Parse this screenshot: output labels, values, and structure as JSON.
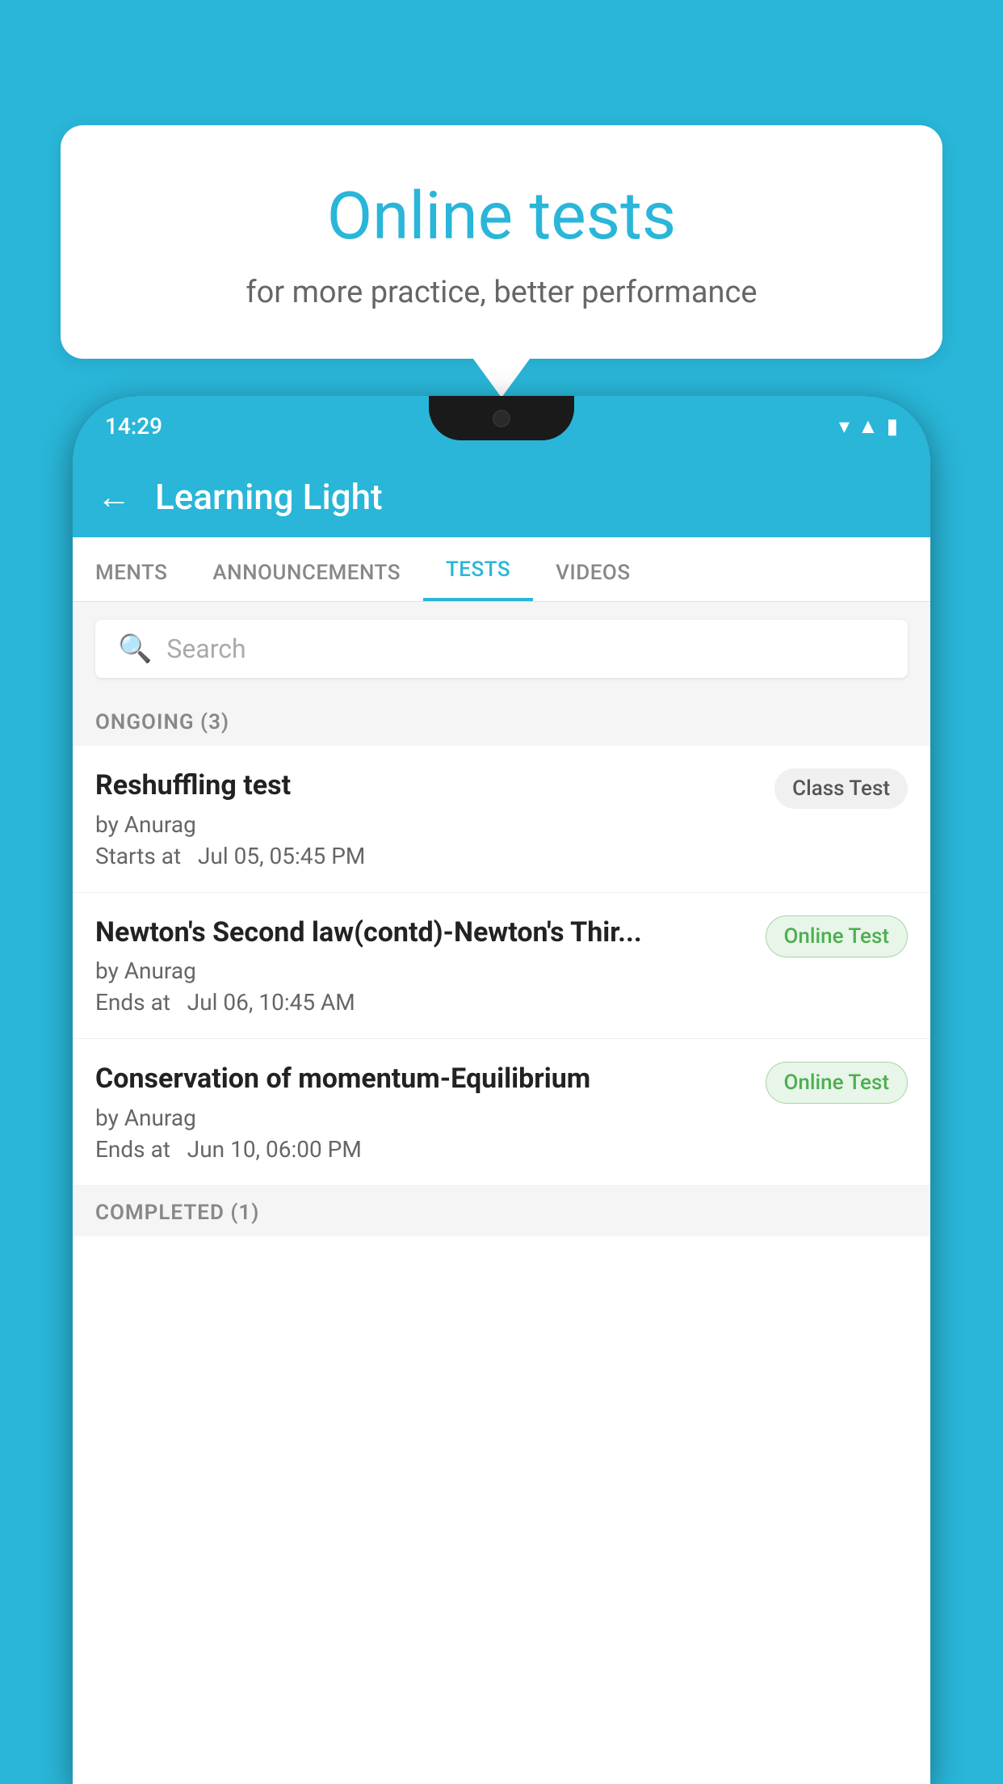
{
  "background": {
    "color": "#29b6d8"
  },
  "speech_bubble": {
    "title": "Online tests",
    "subtitle": "for more practice, better performance"
  },
  "phone": {
    "time": "14:29",
    "status_icons": [
      "wifi",
      "signal",
      "battery"
    ]
  },
  "app": {
    "header": {
      "back_label": "←",
      "title": "Learning Light"
    },
    "tabs": [
      {
        "label": "MENTS",
        "active": false
      },
      {
        "label": "ANNOUNCEMENTS",
        "active": false
      },
      {
        "label": "TESTS",
        "active": true
      },
      {
        "label": "VIDEOS",
        "active": false
      }
    ],
    "search": {
      "placeholder": "Search"
    },
    "ongoing_section": {
      "label": "ONGOING (3)"
    },
    "tests": [
      {
        "name": "Reshuffling test",
        "author": "by Anurag",
        "time_label": "Starts at",
        "time": "Jul 05, 05:45 PM",
        "badge_text": "Class Test",
        "badge_type": "class"
      },
      {
        "name": "Newton's Second law(contd)-Newton's Thir...",
        "author": "by Anurag",
        "time_label": "Ends at",
        "time": "Jul 06, 10:45 AM",
        "badge_text": "Online Test",
        "badge_type": "online"
      },
      {
        "name": "Conservation of momentum-Equilibrium",
        "author": "by Anurag",
        "time_label": "Ends at",
        "time": "Jun 10, 06:00 PM",
        "badge_text": "Online Test",
        "badge_type": "online"
      }
    ],
    "completed_section": {
      "label": "COMPLETED (1)"
    }
  }
}
